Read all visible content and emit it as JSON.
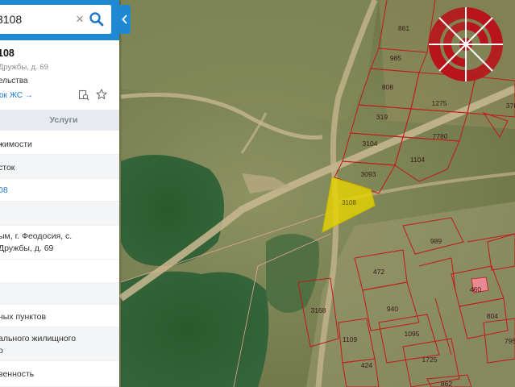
{
  "search": {
    "query": "3108",
    "clear_symbol": "×"
  },
  "info": {
    "title": "108",
    "address": "Дружбы, д. 69",
    "category": "ельства",
    "link": "ок ЖС →"
  },
  "tabs": {
    "services": "Услуги"
  },
  "rows": [
    {
      "text": "жимости"
    },
    {
      "text": "сток"
    },
    {
      "text": "08"
    },
    {
      "text": ""
    },
    {
      "text": "ым, г. Феодосия, с."
    },
    {
      "text": "Дружбы, д. 69"
    },
    {
      "text": ""
    },
    {
      "text": "ных пунктов"
    },
    {
      "text": "ального жилищного"
    },
    {
      "text": "о"
    },
    {
      "text": "венность"
    }
  ],
  "map": {
    "selected_parcel": "3108",
    "parcels": [
      "861",
      "985",
      "808",
      "1275",
      "319",
      "3104",
      "7780",
      "1104",
      "3093",
      "3108",
      "989",
      "472",
      "940",
      "460",
      "804",
      "3168",
      "1095",
      "1109",
      "424",
      "1725",
      "795",
      "862",
      "376"
    ],
    "colors": {
      "parcel_border": "#c01a1a",
      "selected_fill": "#e6d400",
      "logo": "#b8141c",
      "panel_accent": "#1e88d2"
    }
  }
}
